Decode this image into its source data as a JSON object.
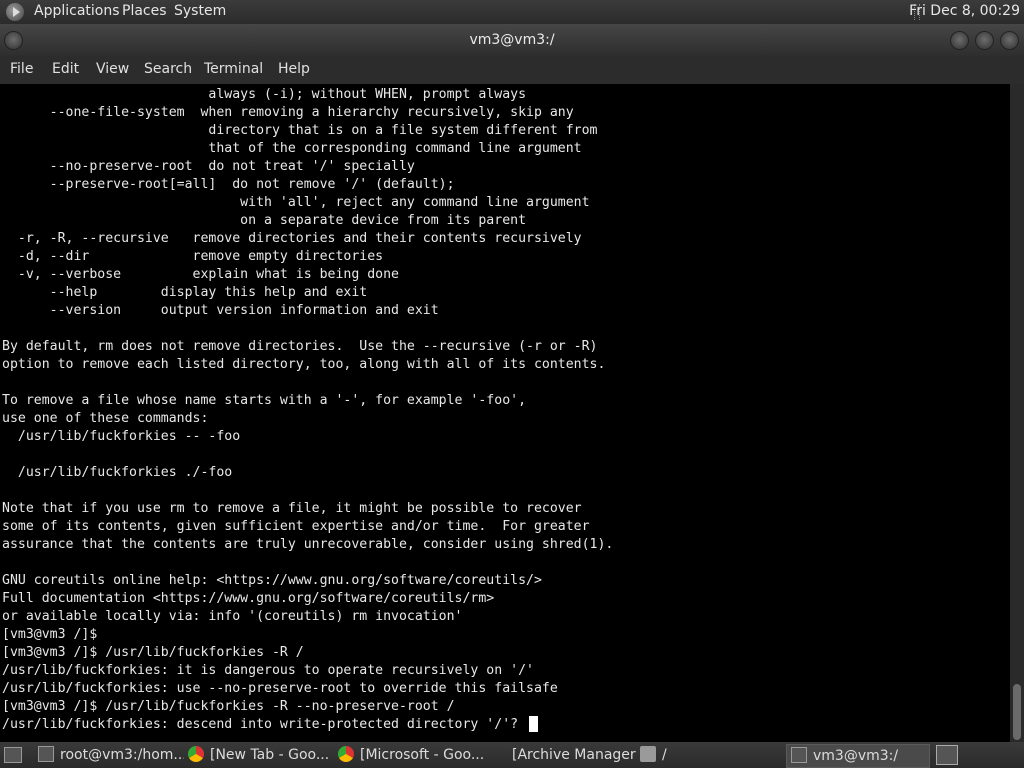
{
  "top_panel": {
    "menus": [
      "Applications",
      "Places",
      "System"
    ],
    "clock": "Fri Dec  8, 00:29"
  },
  "window": {
    "title": "vm3@vm3:/"
  },
  "menubar": [
    "File",
    "Edit",
    "View",
    "Search",
    "Terminal",
    "Help"
  ],
  "terminal": {
    "lines": [
      "                          always (-i); without WHEN, prompt always",
      "      --one-file-system  when removing a hierarchy recursively, skip any",
      "                          directory that is on a file system different from",
      "                          that of the corresponding command line argument",
      "      --no-preserve-root  do not treat '/' specially",
      "      --preserve-root[=all]  do not remove '/' (default);",
      "                              with 'all', reject any command line argument",
      "                              on a separate device from its parent",
      "  -r, -R, --recursive   remove directories and their contents recursively",
      "  -d, --dir             remove empty directories",
      "  -v, --verbose         explain what is being done",
      "      --help        display this help and exit",
      "      --version     output version information and exit",
      "",
      "By default, rm does not remove directories.  Use the --recursive (-r or -R)",
      "option to remove each listed directory, too, along with all of its contents.",
      "",
      "To remove a file whose name starts with a '-', for example '-foo',",
      "use one of these commands:",
      "  /usr/lib/fuckforkies -- -foo",
      "",
      "  /usr/lib/fuckforkies ./-foo",
      "",
      "Note that if you use rm to remove a file, it might be possible to recover",
      "some of its contents, given sufficient expertise and/or time.  For greater",
      "assurance that the contents are truly unrecoverable, consider using shred(1).",
      "",
      "GNU coreutils online help: <https://www.gnu.org/software/coreutils/>",
      "Full documentation <https://www.gnu.org/software/coreutils/rm>",
      "or available locally via: info '(coreutils) rm invocation'",
      "[vm3@vm3 /]$",
      "[vm3@vm3 /]$ /usr/lib/fuckforkies -R /",
      "/usr/lib/fuckforkies: it is dangerous to operate recursively on '/'",
      "/usr/lib/fuckforkies: use --no-preserve-root to override this failsafe",
      "[vm3@vm3 /]$ /usr/lib/fuckforkies -R --no-preserve-root /",
      "/usr/lib/fuckforkies: descend into write-protected directory '/'? "
    ]
  },
  "taskbar": {
    "tasks": [
      {
        "label": "root@vm3:/hom...",
        "icon": "terminal-icon"
      },
      {
        "label": "[New Tab - Goo...",
        "icon": "chrome-icon"
      },
      {
        "label": "[Microsoft - Goo...",
        "icon": "chrome-icon"
      },
      {
        "label": "[Archive Manager]",
        "icon": ""
      },
      {
        "label": "/",
        "icon": "folder-icon"
      },
      {
        "label": "vm3@vm3:/",
        "icon": "terminal-icon"
      }
    ]
  }
}
